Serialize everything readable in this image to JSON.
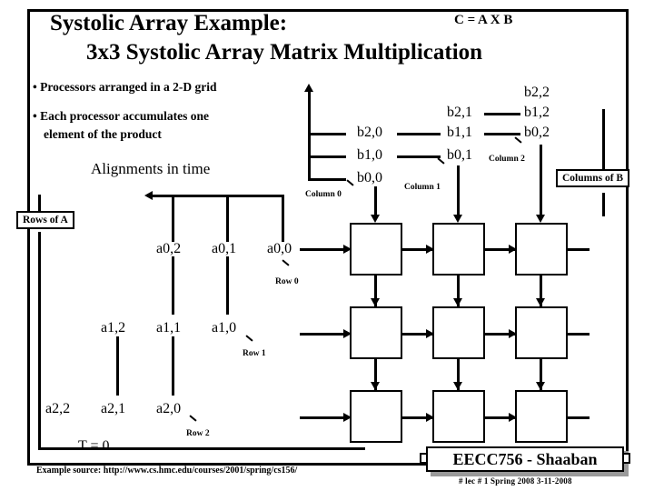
{
  "slide": {
    "title_line1": "Systolic Array  Example:",
    "title_line2": "3x3 Systolic Array Matrix Multiplication",
    "equation": "C = A X B",
    "bullets": [
      "• Processors arranged in a 2-D grid",
      "• Each processor accumulates one",
      "element of the product"
    ],
    "alignments_label": "Alignments in time",
    "rows_of_a_label": "Rows of A",
    "columns_of_b_label": "Columns of B",
    "time_label": "T = 0",
    "source_note": "Example source:  http://www.cs.hmc.edu/courses/2001/spring/cs156/"
  },
  "matrix_b": {
    "column_labels": [
      "Column 0",
      "Column 1",
      "Column 2"
    ],
    "values": {
      "col0": [
        "b2,0",
        "b1,0",
        "b0,0"
      ],
      "col1": [
        "b2,1",
        "b1,1",
        "b0,1"
      ],
      "col2": [
        "b2,2",
        "b1,2",
        "b0,2"
      ]
    }
  },
  "matrix_a": {
    "row_labels": [
      "Row 0",
      "Row 1",
      "Row 2"
    ],
    "values": {
      "row0": [
        "a0,2",
        "a0,1",
        "a0,0"
      ],
      "row1": [
        "a1,2",
        "a1,1",
        "a1,0"
      ],
      "row2": [
        "a2,2",
        "a2,1",
        "a2,0"
      ]
    }
  },
  "grid": {
    "rows": 3,
    "cols": 3,
    "cells": [
      "",
      "",
      "",
      "",
      "",
      "",
      "",
      "",
      ""
    ]
  },
  "footer": {
    "badge": "EECC756 - Shaaban",
    "meta": "#  lec # 1     Spring 2008    3-11-2008"
  },
  "colors": {
    "ink": "#000000",
    "paper": "#ffffff",
    "badge_shadow": "#9a9a9a"
  }
}
